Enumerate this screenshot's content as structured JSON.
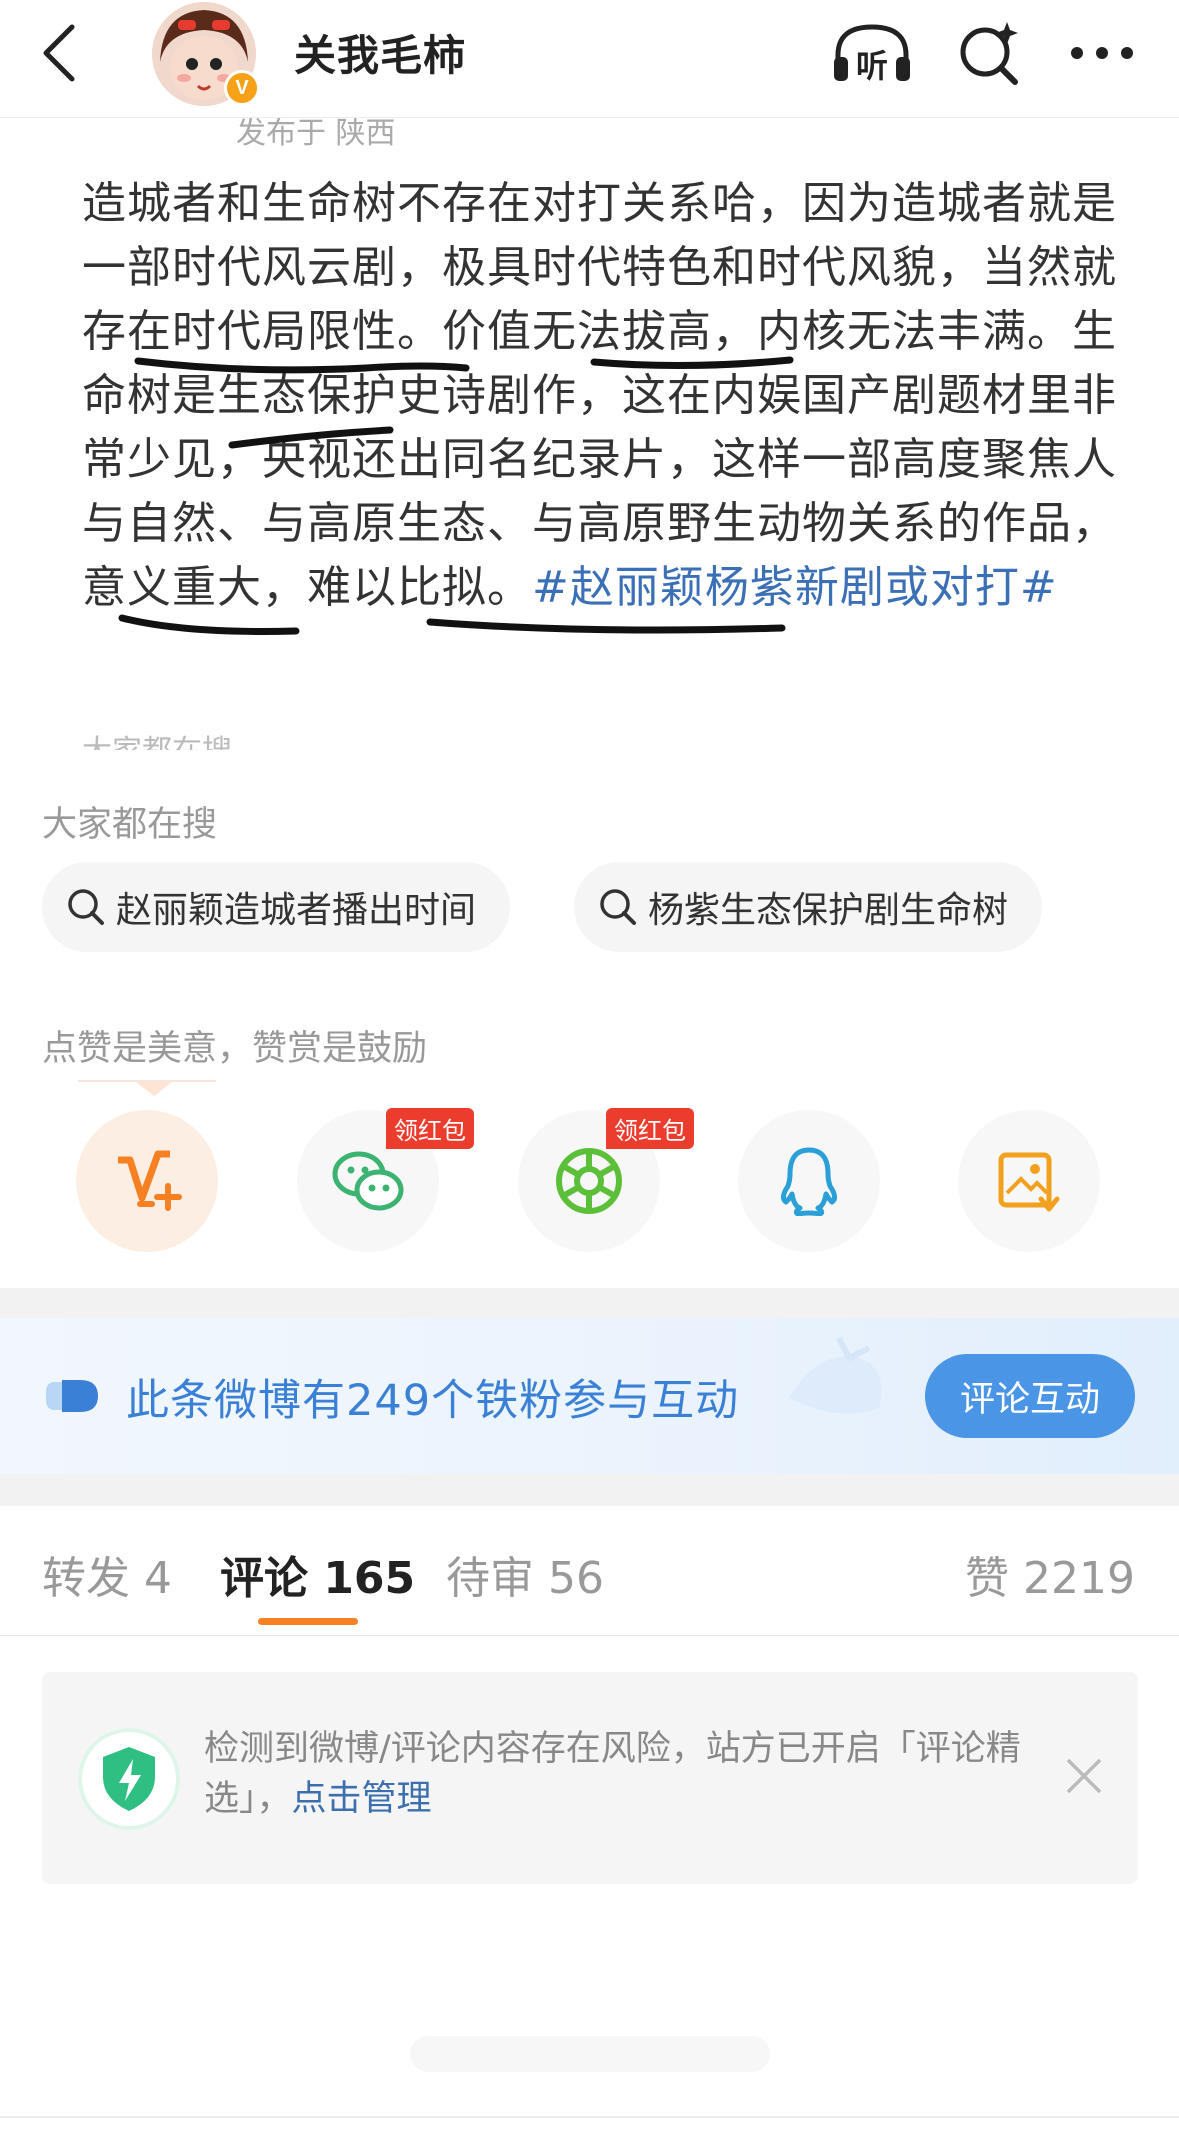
{
  "header": {
    "username": "关我毛柿",
    "verified_mark": "V",
    "icons": [
      "back-arrow-icon",
      "listen-headphone-icon",
      "ai-search-icon",
      "more-icon"
    ],
    "listen_label": "听"
  },
  "post": {
    "meta": "发布于 陕西",
    "text": "造城者和生命树不存在对打关系哈，因为造城者就是一部时代风云剧，极具时代特色和时代风貌，当然就存在时代局限性。价值无法拔高，内核无法丰满。生命树是生态保护史诗剧作，这在内娱国产剧题材里非常少见，央视还出同名纪录片，这样一部高度聚焦人与自然、与高原生态、与高原野生动物关系的作品，意义重大，难以比拟。",
    "hashtag": "#赵丽颖杨紫新剧或对打#",
    "faded_text": "大家都在搜"
  },
  "hot_search": {
    "title": "大家都在搜",
    "items": [
      "赵丽颖造城者播出时间",
      "杨紫生态保护剧生命树"
    ]
  },
  "share": {
    "title": "点赞是美意，赞赏是鼓励",
    "items": [
      {
        "name": "weibo-reward-icon",
        "badge": ""
      },
      {
        "name": "wechat-icon",
        "badge": "领红包"
      },
      {
        "name": "moments-icon",
        "badge": "领红包"
      },
      {
        "name": "qq-icon",
        "badge": ""
      },
      {
        "name": "save-image-icon",
        "badge": ""
      }
    ]
  },
  "banner": {
    "text": "此条微博有249个铁粉参与互动",
    "button": "评论互动"
  },
  "tabs": {
    "repost": "转发 4",
    "comment": "评论 165",
    "pending": "待审 56",
    "like": "赞 2219"
  },
  "notice": {
    "text": "检测到微博/评论内容存在风险，站方已开启「评论精选」，",
    "link": "点击管理"
  },
  "colors": {
    "accent_orange": "#f78122",
    "link_blue": "#3b6fb6",
    "banner_blue": "#3a80d6",
    "redpack_red": "#ec3c2d"
  }
}
